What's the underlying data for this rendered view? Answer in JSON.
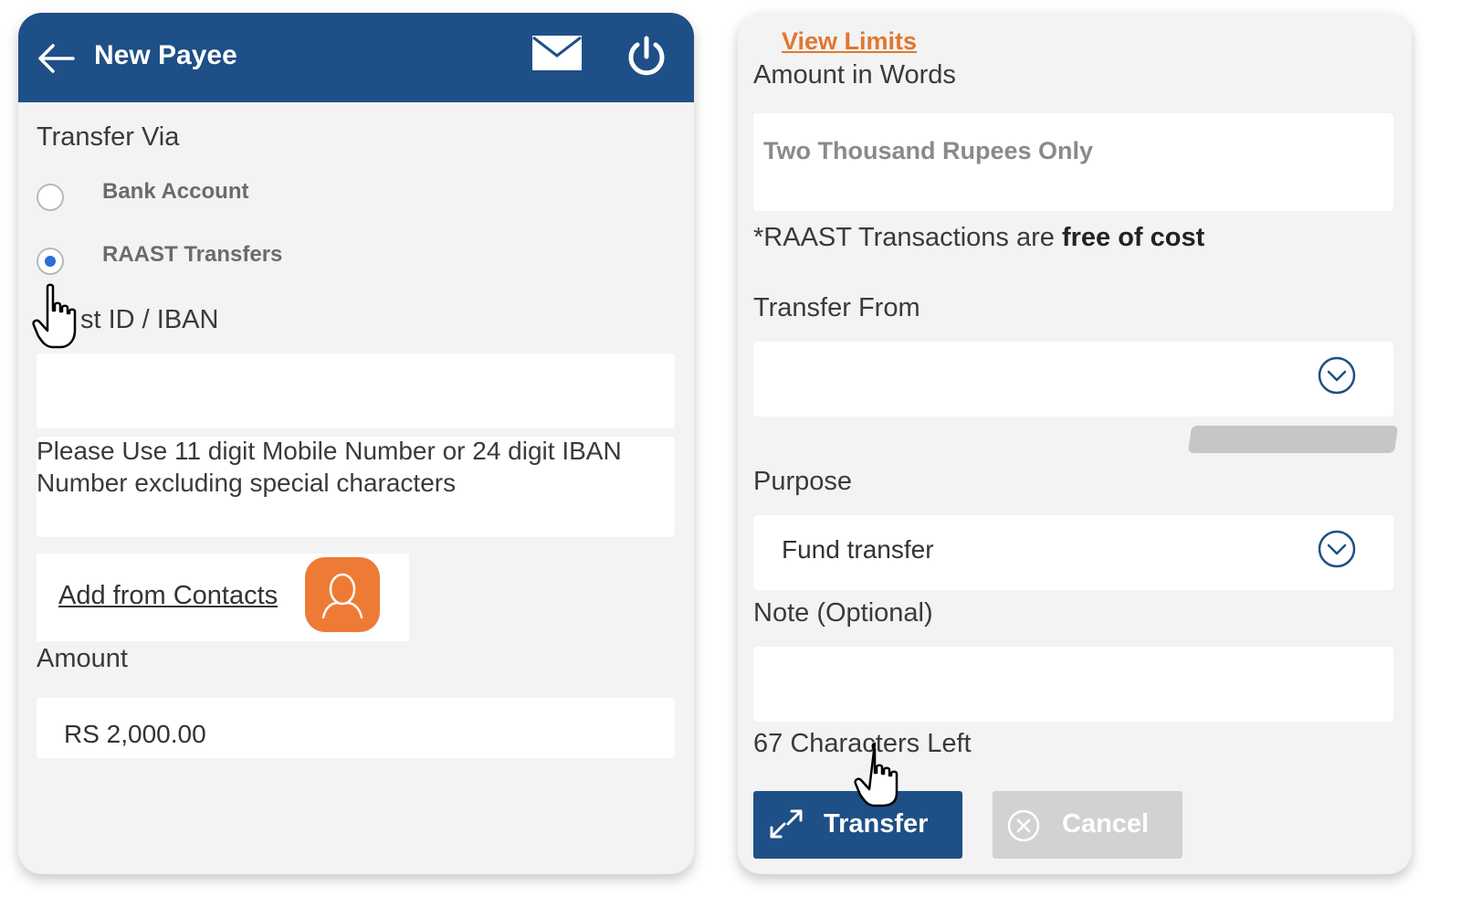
{
  "header": {
    "title": "New Payee"
  },
  "transfer_via": {
    "label": "Transfer Via",
    "options": [
      {
        "label": "Bank Account",
        "selected": false
      },
      {
        "label": "RAAST Transfers",
        "selected": true
      }
    ]
  },
  "raast_id": {
    "label": "st ID / IBAN",
    "value": "",
    "hint": "Please Use 11 digit Mobile Number or 24 digit IBAN Number excluding special characters"
  },
  "contacts": {
    "link_label": "Add from Contacts"
  },
  "amount": {
    "label": "Amount",
    "value": "RS 2,000.00"
  },
  "right": {
    "view_limits": "View Limits",
    "amount_words_label": "Amount in Words",
    "amount_words_value": "Two Thousand Rupees Only",
    "notice_prefix": "*RAAST Transactions are ",
    "notice_bold": "free of cost",
    "transfer_from_label": "Transfer From",
    "transfer_from_value": "",
    "purpose_label": "Purpose",
    "purpose_value": "Fund transfer",
    "note_label": "Note (Optional)",
    "note_value": "",
    "chars_left": "67 Characters Left",
    "transfer_button": "Transfer",
    "cancel_button": "Cancel"
  },
  "colors": {
    "header_bg": "#1e4f86",
    "accent_orange": "#ee7b35",
    "link_orange": "#e0772f",
    "radio_selected": "#2a6fd6",
    "cancel_disabled": "#d2d2d2"
  },
  "icons": [
    "back-arrow-icon",
    "mail-icon",
    "power-icon",
    "contact-person-icon",
    "chevron-down-circle-icon",
    "transfer-arrows-icon",
    "cancel-circle-icon",
    "hand-cursor-icon"
  ]
}
